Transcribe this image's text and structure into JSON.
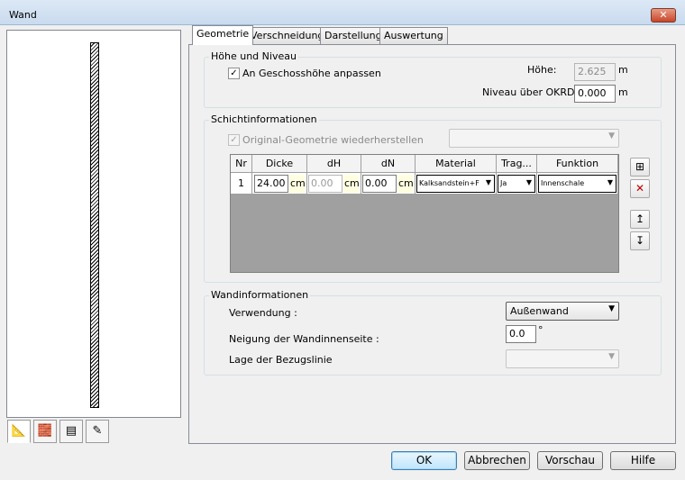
{
  "window": {
    "title": "Wand",
    "close_label": "✕"
  },
  "tabs": [
    "Geometrie",
    "Verschneidung",
    "Darstellung",
    "Auswertung"
  ],
  "hoehe_niveau": {
    "group_label": "Höhe und Niveau",
    "checkbox_label": "An Geschosshöhe anpassen",
    "checkbox_mark": "✓",
    "hoehe_label": "Höhe:",
    "hoehe_value": "2.625",
    "hoehe_unit": "m",
    "niveau_label": "Niveau über OKRD:",
    "niveau_value": "0.000",
    "niveau_unit": "m"
  },
  "schicht": {
    "group_label": "Schichtinformationen",
    "checkbox_label": "Original-Geometrie wiederherstellen",
    "checkbox_mark": "✓",
    "combo_value": "",
    "columns": [
      "Nr",
      "Dicke",
      "dH",
      "dN",
      "Material",
      "Trag...",
      "Funktion"
    ],
    "row": {
      "nr": "1",
      "dicke": "24.00",
      "dicke_unit": "cm",
      "dh": "0.00",
      "dh_unit": "cm",
      "dn": "0.00",
      "dn_unit": "cm",
      "material": "Kalksandstein+F",
      "trag": "Ja",
      "funktion": "Innenschale"
    }
  },
  "wand": {
    "group_label": "Wandinformationen",
    "verwendung_label": "Verwendung :",
    "verwendung_value": "Außenwand",
    "neigung_label": "Neigung der Wandinnenseite :",
    "neigung_value": "0.0",
    "neigung_unit": "°",
    "lage_label": "Lage der Bezugslinie",
    "lage_value": ""
  },
  "buttons": {
    "ok": "OK",
    "cancel": "Abbrechen",
    "preview": "Vorschau",
    "help": "Hilfe"
  },
  "side_buttons": {
    "add": "⊞",
    "delete": "✕",
    "up": "↥",
    "down": "↧"
  },
  "preview_tabs": [
    "📐",
    "🧱",
    "▤",
    "✎"
  ]
}
